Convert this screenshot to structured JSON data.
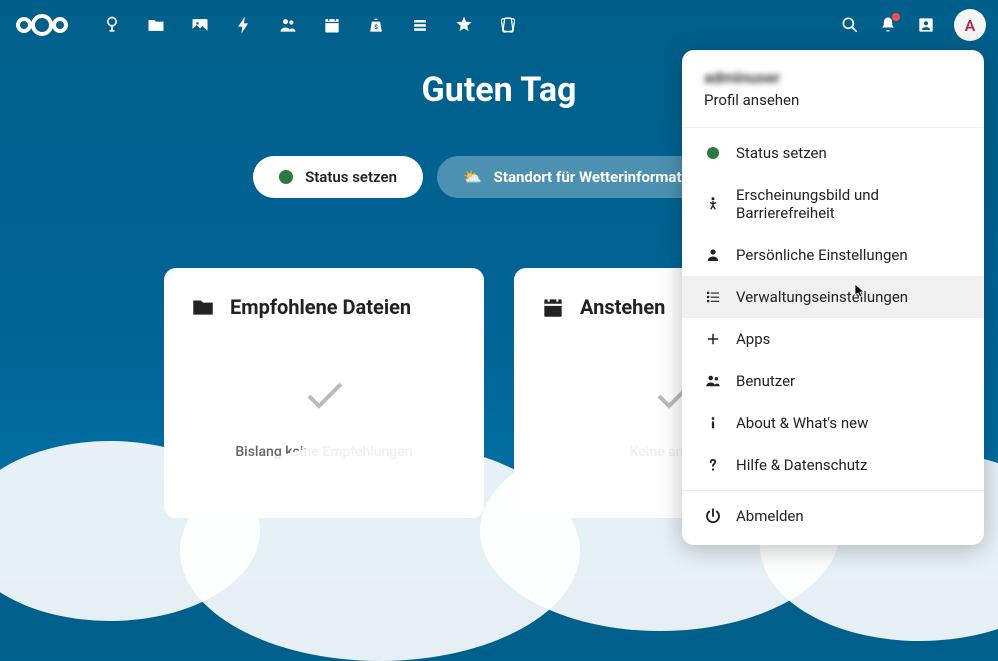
{
  "header": {
    "avatar_initial": "A"
  },
  "greeting": "Guten Tag",
  "pills": {
    "status": "Status setzen",
    "weather": "Standort für Wetterinformationen"
  },
  "cards": {
    "recommended": {
      "title": "Empfohlene Dateien",
      "empty": "Bislang keine Empfehlungen"
    },
    "upcoming": {
      "title": "Anstehen",
      "empty": "Keine anstehe"
    }
  },
  "menu": {
    "username": "adminuser",
    "view_profile": "Profil ansehen",
    "items": {
      "status": "Status setzen",
      "appearance": "Erscheinungsbild und Barrierefreiheit",
      "personal": "Persönliche Einstellungen",
      "admin": "Verwaltungseinstellungen",
      "apps": "Apps",
      "users": "Benutzer",
      "about": "About & What's new",
      "help": "Hilfe & Datenschutz",
      "logout": "Abmelden"
    }
  }
}
